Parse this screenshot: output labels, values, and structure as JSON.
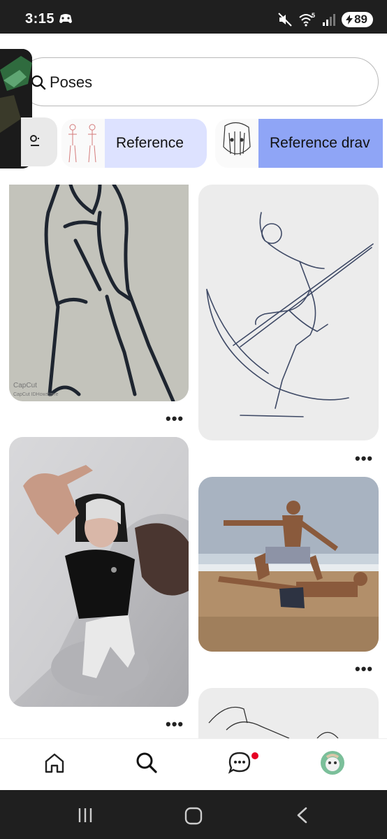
{
  "status_bar": {
    "time": "3:15",
    "network": "5",
    "battery": "89"
  },
  "search": {
    "query": "Poses"
  },
  "chips": [
    {
      "label": "Reference"
    },
    {
      "label": "Reference drav"
    }
  ],
  "pins": [
    {
      "description_icon": "sketch-legs"
    },
    {
      "description_icon": "sketch-scythe"
    },
    {
      "description_icon": "photo-girl"
    },
    {
      "description_icon": "photo-beach"
    },
    {
      "description_icon": "sketch-partial"
    }
  ],
  "watermark": {
    "text": "CapCut",
    "subtext": "CapCut IDHowstarre"
  },
  "more_label": "•••",
  "colors": {
    "chip_light": "#dde2ff",
    "chip_blue": "#8fa5f6",
    "notification": "#e60023"
  },
  "nav": {
    "items": [
      "home",
      "search",
      "messages",
      "profile"
    ]
  }
}
